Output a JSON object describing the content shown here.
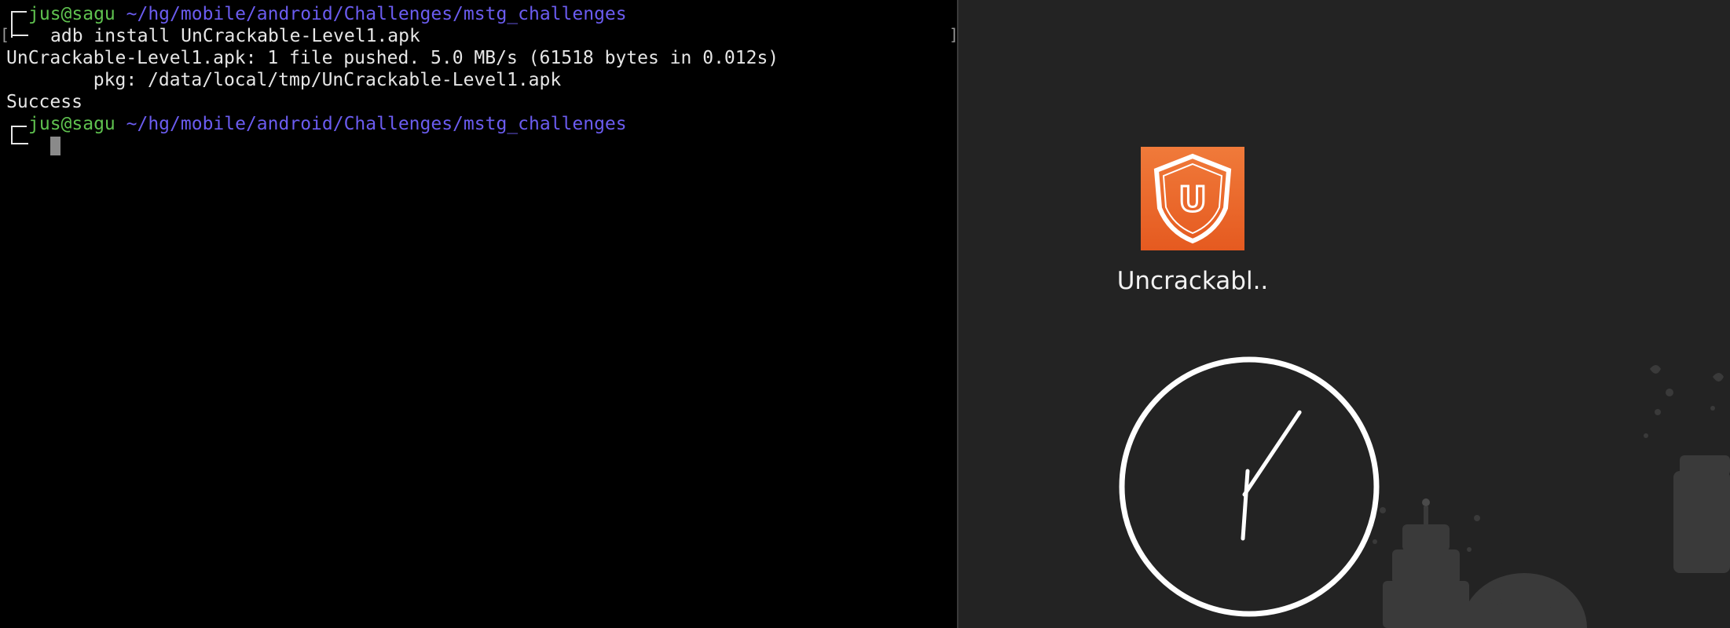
{
  "terminal": {
    "prompt1": {
      "user": "jus@sagu",
      "path": "~/hg/mobile/android/Challenges/mstg_challenges"
    },
    "command": "adb install UnCrackable-Level1.apk",
    "output": [
      "UnCrackable-Level1.apk: 1 file pushed. 5.0 MB/s (61518 bytes in 0.012s)",
      "        pkg: /data/local/tmp/UnCrackable-Level1.apk",
      "Success"
    ],
    "prompt2": {
      "user": "jus@sagu",
      "path": "~/hg/mobile/android/Challenges/mstg_challenges"
    }
  },
  "android": {
    "app_label": "Uncrackabl..",
    "icon_letter": "U",
    "colors": {
      "icon": "#e55a20",
      "background": "#232323"
    }
  },
  "colors": {
    "user": "#5fc24f",
    "path": "#6b5cf0",
    "text": "#e6e6e6"
  }
}
